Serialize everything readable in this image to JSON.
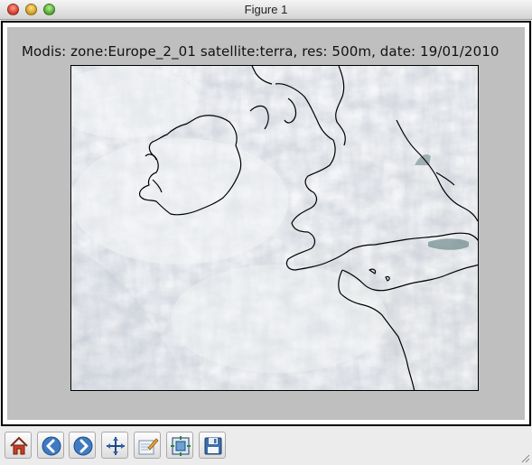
{
  "window": {
    "title": "Figure 1"
  },
  "figure": {
    "title": "Modis: zone:Europe_2_01 satellite:terra, res: 500m, date: 19/01/2010"
  },
  "toolbar": {
    "buttons": [
      {
        "name": "home",
        "icon": "home-icon"
      },
      {
        "name": "back",
        "icon": "back-arrow-icon"
      },
      {
        "name": "forward",
        "icon": "forward-arrow-icon"
      },
      {
        "name": "pan",
        "icon": "pan-move-icon"
      },
      {
        "name": "zoom",
        "icon": "zoom-rect-icon"
      },
      {
        "name": "subplots",
        "icon": "subplots-config-icon"
      },
      {
        "name": "save",
        "icon": "floppy-disk-icon"
      }
    ]
  },
  "colors": {
    "figure_background": "#bfbfbf",
    "sea_dark": "#1c2b52",
    "cloud": "#eef0f3",
    "coastline": "#000000"
  }
}
